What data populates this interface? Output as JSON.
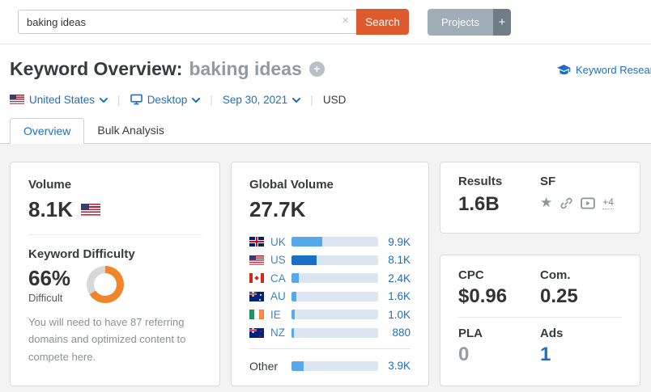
{
  "topbar": {
    "search_value": "baking ideas",
    "clear_label": "×",
    "search_button": "Search",
    "projects_button": "Projects",
    "projects_plus": "+"
  },
  "header": {
    "title": "Keyword Overview:",
    "keyword": "baking ideas",
    "add_label": "+",
    "research_link": "Keyword Research"
  },
  "filters": {
    "country": "United States",
    "device": "Desktop",
    "date": "Sep 30, 2021",
    "currency": "USD"
  },
  "tabs": {
    "overview": "Overview",
    "bulk": "Bulk Analysis"
  },
  "volume_card": {
    "title": "Volume",
    "value": "8.1K",
    "kd_title": "Keyword Difficulty",
    "kd_value": "66%",
    "kd_percent": 66,
    "kd_label": "Difficult",
    "kd_note": "You will need to have 87 referring domains and optimized content to compete here."
  },
  "global_card": {
    "title": "Global Volume",
    "value": "27.7K",
    "rows": [
      {
        "flag": "uk",
        "code": "UK",
        "value": "9.9K",
        "pct": 35.7,
        "shade": "light"
      },
      {
        "flag": "us",
        "code": "US",
        "value": "8.1K",
        "pct": 29.2,
        "shade": "dark"
      },
      {
        "flag": "ca",
        "code": "CA",
        "value": "2.4K",
        "pct": 8.7,
        "shade": "light"
      },
      {
        "flag": "au",
        "code": "AU",
        "value": "1.6K",
        "pct": 5.8,
        "shade": "light"
      },
      {
        "flag": "ie",
        "code": "IE",
        "value": "1.0K",
        "pct": 3.6,
        "shade": "light"
      },
      {
        "flag": "nz",
        "code": "NZ",
        "value": "880",
        "pct": 3.2,
        "shade": "light"
      }
    ],
    "other": {
      "label": "Other",
      "value": "3.9K",
      "pct": 14.1,
      "shade": "light"
    }
  },
  "results_card": {
    "results_label": "Results",
    "results_value": "1.6B",
    "sf_label": "SF",
    "sf_more": "+4"
  },
  "cpc_card": {
    "cpc_label": "CPC",
    "cpc_value": "$0.96",
    "com_label": "Com.",
    "com_value": "0.25",
    "pla_label": "PLA",
    "pla_value": "0",
    "ads_label": "Ads",
    "ads_value": "1"
  },
  "colors": {
    "search_orange": "#dc5a2e",
    "link_blue": "#1f6fc0",
    "bar_track": "#dce6f1",
    "bar_light": "#57a9ec",
    "bar_dark": "#1a70c4",
    "kd_orange": "#f0862b",
    "kd_track": "#d8d8d8"
  }
}
